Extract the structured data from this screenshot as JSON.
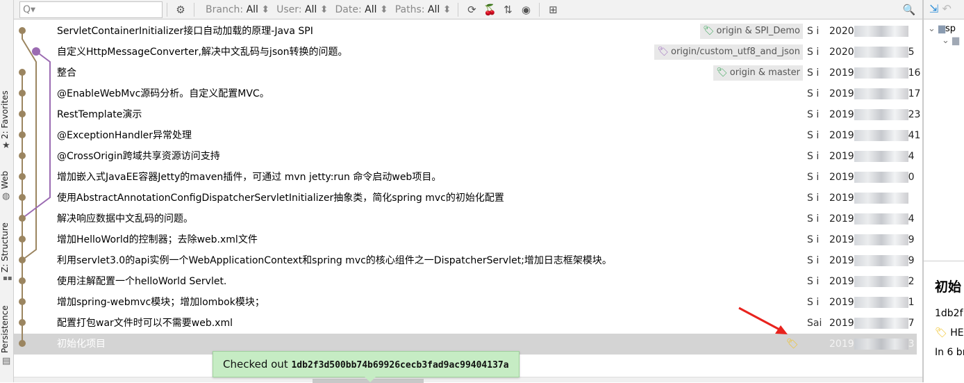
{
  "sidebar_tabs": [
    "2: Favorites",
    "Web",
    "Z: Structure",
    "Persistence"
  ],
  "toolbar": {
    "search_placeholder": "Q▾",
    "filters": [
      {
        "label": "Branch:",
        "value": "All"
      },
      {
        "label": "User:",
        "value": "All"
      },
      {
        "label": "Date:",
        "value": "All"
      },
      {
        "label": "Paths:",
        "value": "All"
      }
    ],
    "icons": [
      "settings-icon",
      "refresh-icon",
      "cherry-pick-icon",
      "sort-icon",
      "eye-icon",
      "new-tab-icon",
      "search-icon"
    ]
  },
  "colors": {
    "main_branch": "#9b8560",
    "feature_branch": "#9b6bb2",
    "tag_green": "#3aa65a",
    "tag_purple": "#a070c0",
    "tag_yellow": "#f0c020",
    "toast_bg": "#c6ecc4"
  },
  "commits": [
    {
      "message": "ServletContainerInitializer接口自动加载的原理-Java SPI",
      "tag": "origin & SPI_Demo",
      "tag_color": "#3aa65a",
      "author": "S  i",
      "date": "2020"
    },
    {
      "message": "自定义HttpMessageConverter,解决中文乱码与json转换的问题。",
      "tag": "origin/custom_utf8_and_json",
      "tag_color": "#a070c0",
      "author": "S  i",
      "date": "2020",
      "date_end": "5"
    },
    {
      "message": "整合",
      "tag": "origin & master",
      "tag_color": "#3aa65a",
      "author": "S  i",
      "date": "2019",
      "date_end": "16"
    },
    {
      "message": "@EnableWebMvc源码分析。自定义配置MVC。",
      "author": "S  i",
      "date": "2019",
      "date_end": "17"
    },
    {
      "message": "RestTemplate演示",
      "author": "S  i",
      "date": "2019",
      "date_end": "23"
    },
    {
      "message": "@ExceptionHandler异常处理",
      "author": "S  i",
      "date": "2019",
      "date_end": "41"
    },
    {
      "message": "@CrossOrigin跨域共享资源访问支持",
      "author": "S  i",
      "date": "2019",
      "date_end": "4"
    },
    {
      "message": "增加嵌入式JavaEE容器Jetty的maven插件，可通过 mvn jetty:run 命令启动web项目。",
      "author": "S  i",
      "date": "2019",
      "date_end": "0"
    },
    {
      "message": "使用AbstractAnnotationConfigDispatcherServletInitializer抽象类，简化spring mvc的初始化配置",
      "author": "S  i",
      "date": "2019"
    },
    {
      "message": "解决响应数据中文乱码的问题。",
      "author": "S  i",
      "date": "2019",
      "date_end": "4"
    },
    {
      "message": "增加HelloWorld的控制器；去除web.xml文件",
      "author": "S  i",
      "date": "2019",
      "date_end": "9"
    },
    {
      "message": "利用servlet3.0的api实例一个WebApplicationContext和spring mvc的核心组件之一DispatcherServlet;增加日志框架模块。",
      "author": "S  i",
      "date": "2019",
      "date_end": "9"
    },
    {
      "message": "使用注解配置一个helloWorld Servlet.",
      "author": "S  i",
      "date": "2019",
      "date_end": "2"
    },
    {
      "message": "增加spring-webmvc模块；增加lombok模块；",
      "author": "S  i",
      "date": "2019",
      "date_end": "1"
    },
    {
      "message": "配置打包war文件时可以不需要web.xml",
      "author": "Sai",
      "date": "2019",
      "date_end": "7"
    },
    {
      "message": "初始化项目",
      "tag_icon_only": true,
      "tag_color": "#f0c020",
      "author": "",
      "date": "2019",
      "date_end": "3",
      "selected": true
    }
  ],
  "toast": {
    "prefix": "Checked out",
    "hash": "1db2f3d500bb74b69926cecb3fad9ac99404137a"
  },
  "details": {
    "title": "初始",
    "hash": "1db2f",
    "head": "HE",
    "branches": "In 6 br",
    "tree_root": "sp"
  }
}
